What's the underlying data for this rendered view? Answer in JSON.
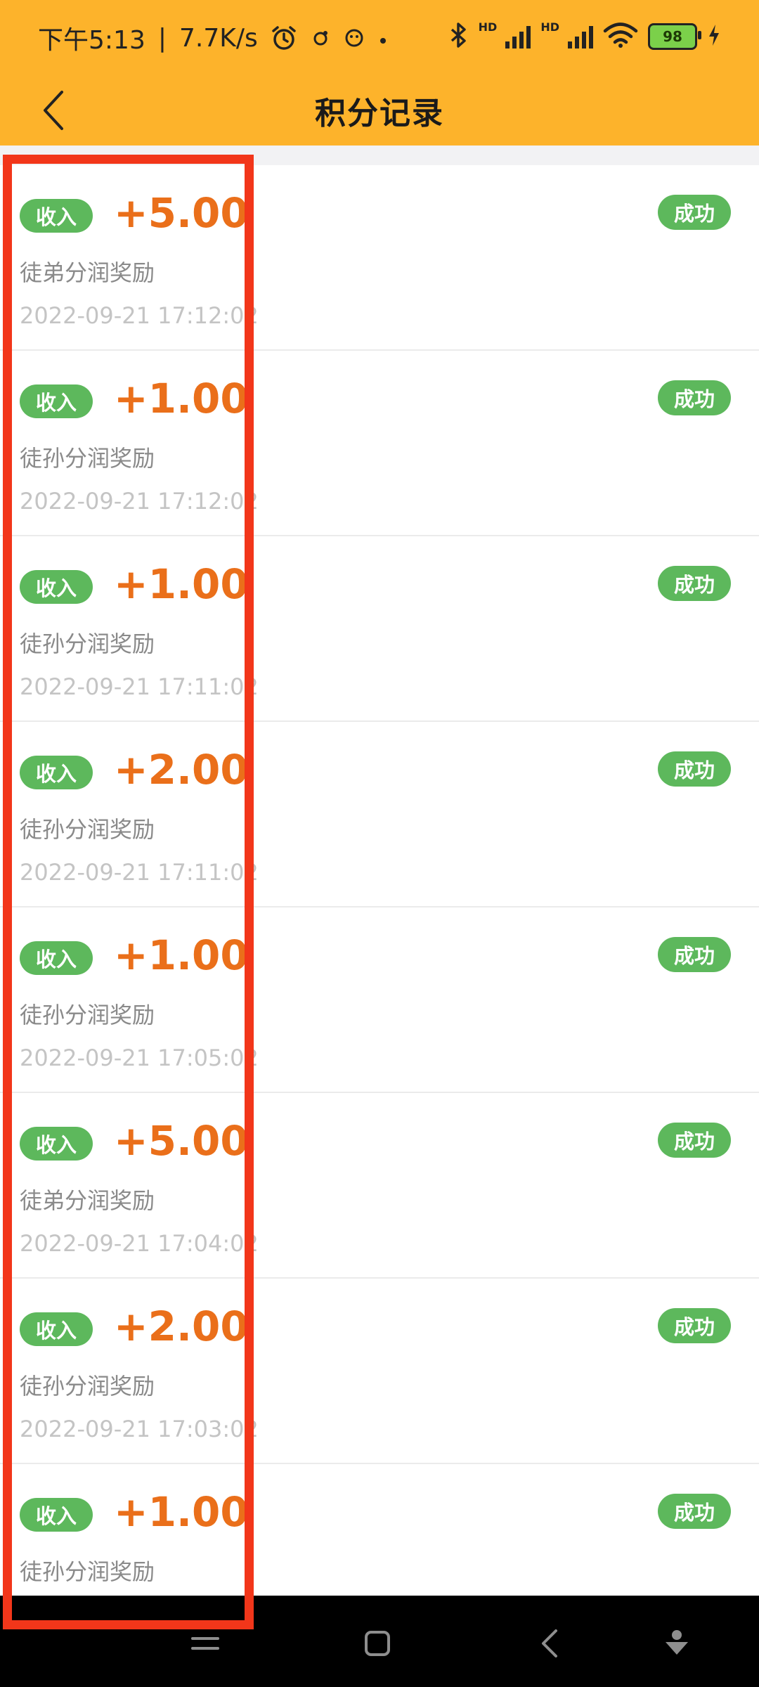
{
  "status_bar": {
    "time": "下午5:13",
    "separator": "|",
    "network_speed": "7.7K/s",
    "battery_level": "98",
    "hd_label": "HD",
    "icons": [
      "alarm-icon",
      "notification-icon",
      "bluetooth-icon",
      "signal-icon",
      "wifi-icon",
      "battery-icon",
      "charging-icon"
    ]
  },
  "header": {
    "title": "积分记录"
  },
  "records": [
    {
      "type": "收入",
      "amount": "+5.00",
      "description": "徒弟分润奖励",
      "datetime": "2022-09-21 17:12:02",
      "status": "成功"
    },
    {
      "type": "收入",
      "amount": "+1.00",
      "description": "徒孙分润奖励",
      "datetime": "2022-09-21 17:12:02",
      "status": "成功"
    },
    {
      "type": "收入",
      "amount": "+1.00",
      "description": "徒孙分润奖励",
      "datetime": "2022-09-21 17:11:02",
      "status": "成功"
    },
    {
      "type": "收入",
      "amount": "+2.00",
      "description": "徒孙分润奖励",
      "datetime": "2022-09-21 17:11:02",
      "status": "成功"
    },
    {
      "type": "收入",
      "amount": "+1.00",
      "description": "徒孙分润奖励",
      "datetime": "2022-09-21 17:05:02",
      "status": "成功"
    },
    {
      "type": "收入",
      "amount": "+5.00",
      "description": "徒弟分润奖励",
      "datetime": "2022-09-21 17:04:02",
      "status": "成功"
    },
    {
      "type": "收入",
      "amount": "+2.00",
      "description": "徒孙分润奖励",
      "datetime": "2022-09-21 17:03:02",
      "status": "成功"
    },
    {
      "type": "收入",
      "amount": "+1.00",
      "description": "徒孙分润奖励",
      "datetime": "",
      "status": "成功"
    }
  ],
  "colors": {
    "header_bg": "#fdb32b",
    "badge_green": "#5db85c",
    "amount_orange": "#ea6f1a",
    "highlight_red": "#f2361a"
  }
}
